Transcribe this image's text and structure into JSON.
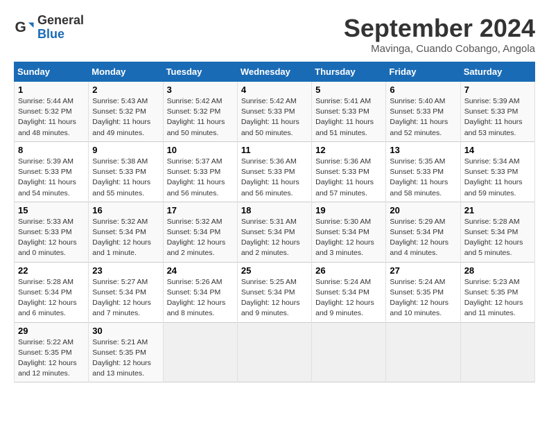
{
  "header": {
    "logo": {
      "general": "General",
      "blue": "Blue"
    },
    "title": "September 2024",
    "location": "Mavinga, Cuando Cobango, Angola"
  },
  "calendar": {
    "days_of_week": [
      "Sunday",
      "Monday",
      "Tuesday",
      "Wednesday",
      "Thursday",
      "Friday",
      "Saturday"
    ],
    "weeks": [
      [
        null,
        {
          "day": 2,
          "sunrise": "5:43 AM",
          "sunset": "5:32 PM",
          "daylight": "11 hours and 49 minutes."
        },
        {
          "day": 3,
          "sunrise": "5:42 AM",
          "sunset": "5:32 PM",
          "daylight": "11 hours and 50 minutes."
        },
        {
          "day": 4,
          "sunrise": "5:42 AM",
          "sunset": "5:33 PM",
          "daylight": "11 hours and 50 minutes."
        },
        {
          "day": 5,
          "sunrise": "5:41 AM",
          "sunset": "5:33 PM",
          "daylight": "11 hours and 51 minutes."
        },
        {
          "day": 6,
          "sunrise": "5:40 AM",
          "sunset": "5:33 PM",
          "daylight": "11 hours and 52 minutes."
        },
        {
          "day": 7,
          "sunrise": "5:39 AM",
          "sunset": "5:33 PM",
          "daylight": "11 hours and 53 minutes."
        }
      ],
      [
        {
          "day": 1,
          "sunrise": "5:44 AM",
          "sunset": "5:32 PM",
          "daylight": "11 hours and 48 minutes."
        },
        {
          "day": 9,
          "sunrise": "5:38 AM",
          "sunset": "5:33 PM",
          "daylight": "11 hours and 55 minutes."
        },
        {
          "day": 10,
          "sunrise": "5:37 AM",
          "sunset": "5:33 PM",
          "daylight": "11 hours and 56 minutes."
        },
        {
          "day": 11,
          "sunrise": "5:36 AM",
          "sunset": "5:33 PM",
          "daylight": "11 hours and 56 minutes."
        },
        {
          "day": 12,
          "sunrise": "5:36 AM",
          "sunset": "5:33 PM",
          "daylight": "11 hours and 57 minutes."
        },
        {
          "day": 13,
          "sunrise": "5:35 AM",
          "sunset": "5:33 PM",
          "daylight": "11 hours and 58 minutes."
        },
        {
          "day": 14,
          "sunrise": "5:34 AM",
          "sunset": "5:33 PM",
          "daylight": "11 hours and 59 minutes."
        }
      ],
      [
        {
          "day": 8,
          "sunrise": "5:39 AM",
          "sunset": "5:33 PM",
          "daylight": "11 hours and 54 minutes."
        },
        {
          "day": 16,
          "sunrise": "5:32 AM",
          "sunset": "5:34 PM",
          "daylight": "12 hours and 1 minute."
        },
        {
          "day": 17,
          "sunrise": "5:32 AM",
          "sunset": "5:34 PM",
          "daylight": "12 hours and 2 minutes."
        },
        {
          "day": 18,
          "sunrise": "5:31 AM",
          "sunset": "5:34 PM",
          "daylight": "12 hours and 2 minutes."
        },
        {
          "day": 19,
          "sunrise": "5:30 AM",
          "sunset": "5:34 PM",
          "daylight": "12 hours and 3 minutes."
        },
        {
          "day": 20,
          "sunrise": "5:29 AM",
          "sunset": "5:34 PM",
          "daylight": "12 hours and 4 minutes."
        },
        {
          "day": 21,
          "sunrise": "5:28 AM",
          "sunset": "5:34 PM",
          "daylight": "12 hours and 5 minutes."
        }
      ],
      [
        {
          "day": 15,
          "sunrise": "5:33 AM",
          "sunset": "5:33 PM",
          "daylight": "12 hours and 0 minutes."
        },
        {
          "day": 23,
          "sunrise": "5:27 AM",
          "sunset": "5:34 PM",
          "daylight": "12 hours and 7 minutes."
        },
        {
          "day": 24,
          "sunrise": "5:26 AM",
          "sunset": "5:34 PM",
          "daylight": "12 hours and 8 minutes."
        },
        {
          "day": 25,
          "sunrise": "5:25 AM",
          "sunset": "5:34 PM",
          "daylight": "12 hours and 9 minutes."
        },
        {
          "day": 26,
          "sunrise": "5:24 AM",
          "sunset": "5:34 PM",
          "daylight": "12 hours and 9 minutes."
        },
        {
          "day": 27,
          "sunrise": "5:24 AM",
          "sunset": "5:35 PM",
          "daylight": "12 hours and 10 minutes."
        },
        {
          "day": 28,
          "sunrise": "5:23 AM",
          "sunset": "5:35 PM",
          "daylight": "12 hours and 11 minutes."
        }
      ],
      [
        {
          "day": 22,
          "sunrise": "5:28 AM",
          "sunset": "5:34 PM",
          "daylight": "12 hours and 6 minutes."
        },
        {
          "day": 30,
          "sunrise": "5:21 AM",
          "sunset": "5:35 PM",
          "daylight": "12 hours and 13 minutes."
        },
        null,
        null,
        null,
        null,
        null
      ],
      [
        {
          "day": 29,
          "sunrise": "5:22 AM",
          "sunset": "5:35 PM",
          "daylight": "12 hours and 12 minutes."
        },
        null,
        null,
        null,
        null,
        null,
        null
      ]
    ]
  }
}
